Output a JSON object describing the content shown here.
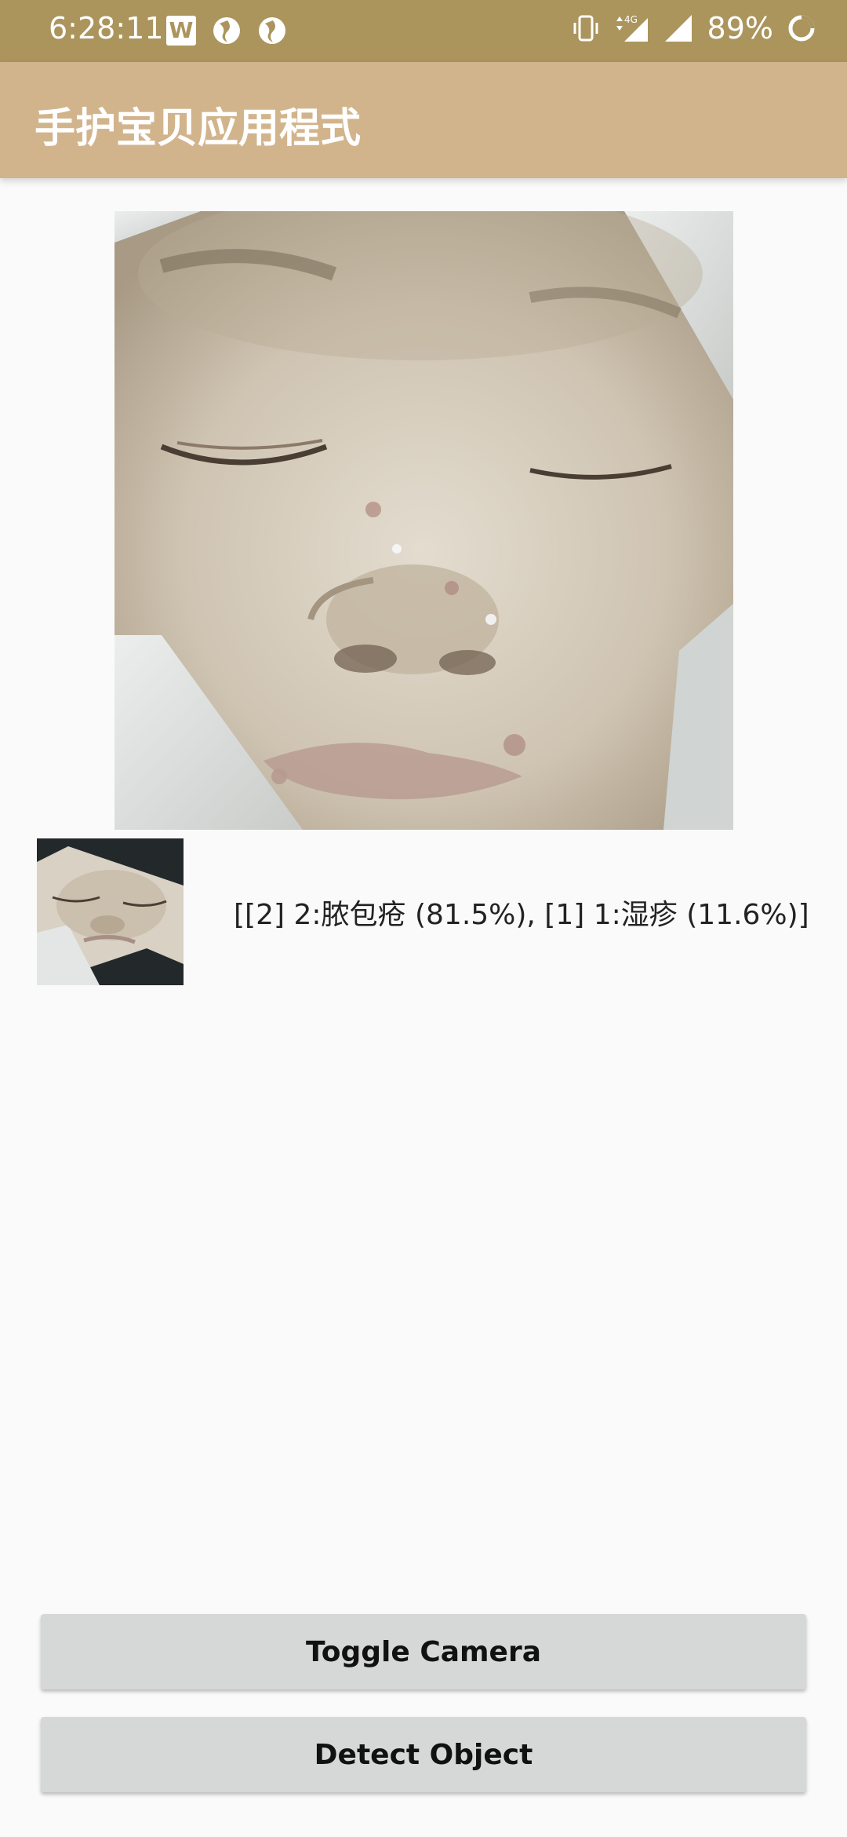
{
  "status_bar": {
    "time": "6:28:11",
    "battery": "89%",
    "network": "4G",
    "icons": [
      "w-app-icon",
      "globe-icon",
      "globe-icon",
      "vibrate-icon",
      "signal-4g-icon",
      "signal-icon",
      "battery-icon"
    ]
  },
  "app_bar": {
    "title": "手护宝贝应用程式"
  },
  "camera": {
    "preview_description": "face-photo",
    "thumbnail_description": "face-photo-thumbnail"
  },
  "result": {
    "text": "[[2] 2:脓包疮 (81.5%), [1] 1:湿疹 (11.6%)]"
  },
  "buttons": {
    "toggle_camera": "Toggle Camera",
    "detect_object": "Detect Object"
  },
  "colors": {
    "status_bar": "#ab955d",
    "app_bar": "#d2b48c",
    "background": "#fafafa",
    "button": "#d6d7d7"
  }
}
